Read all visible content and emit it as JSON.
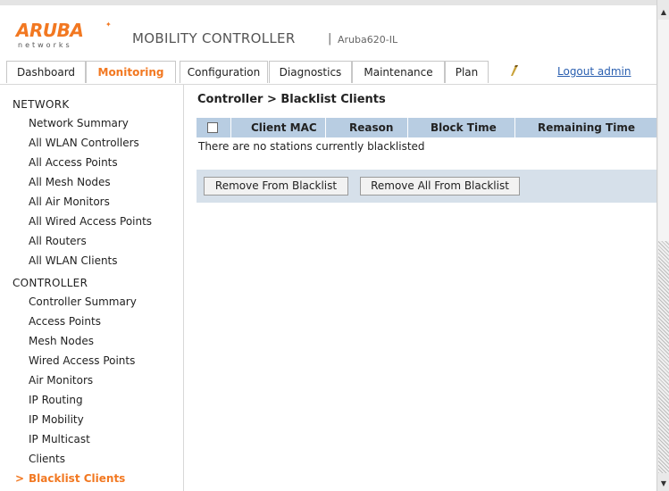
{
  "header": {
    "logo_text": "ARUBA",
    "logo_sub": "networks",
    "product": "MOBILITY CONTROLLER",
    "separator": "|",
    "hostname": "Aruba620-IL"
  },
  "tabs": [
    {
      "label": "Dashboard"
    },
    {
      "label": "Monitoring",
      "active": true
    },
    {
      "label": "Configuration"
    },
    {
      "label": "Diagnostics"
    },
    {
      "label": "Maintenance"
    },
    {
      "label": "Plan"
    }
  ],
  "logout": "Logout admin",
  "sidebar": {
    "network_head": "NETWORK",
    "network_items": [
      "Network Summary",
      "All WLAN Controllers",
      "All Access Points",
      "All Mesh Nodes",
      "All Air Monitors",
      "All Wired Access Points",
      "All Routers",
      "All WLAN Clients"
    ],
    "controller_head": "CONTROLLER",
    "controller_items": [
      "Controller Summary",
      "Access Points",
      "Mesh Nodes",
      "Wired Access Points",
      "Air Monitors",
      "IP Routing",
      "IP Mobility",
      "IP Multicast",
      "Clients"
    ],
    "active_item": "Blacklist Clients",
    "active_marker": ">"
  },
  "main": {
    "title": "Controller > Blacklist Clients",
    "columns": [
      "Client MAC",
      "Reason",
      "Block Time",
      "Remaining Time"
    ],
    "empty_message": "There are no stations currently blacklisted",
    "buttons": {
      "remove": "Remove From Blacklist",
      "remove_all": "Remove All From Blacklist"
    }
  },
  "colors": {
    "accent": "#f27821",
    "table_header": "#b8cde2",
    "button_bar": "#d6e0ea",
    "link": "#2a5fb0"
  }
}
